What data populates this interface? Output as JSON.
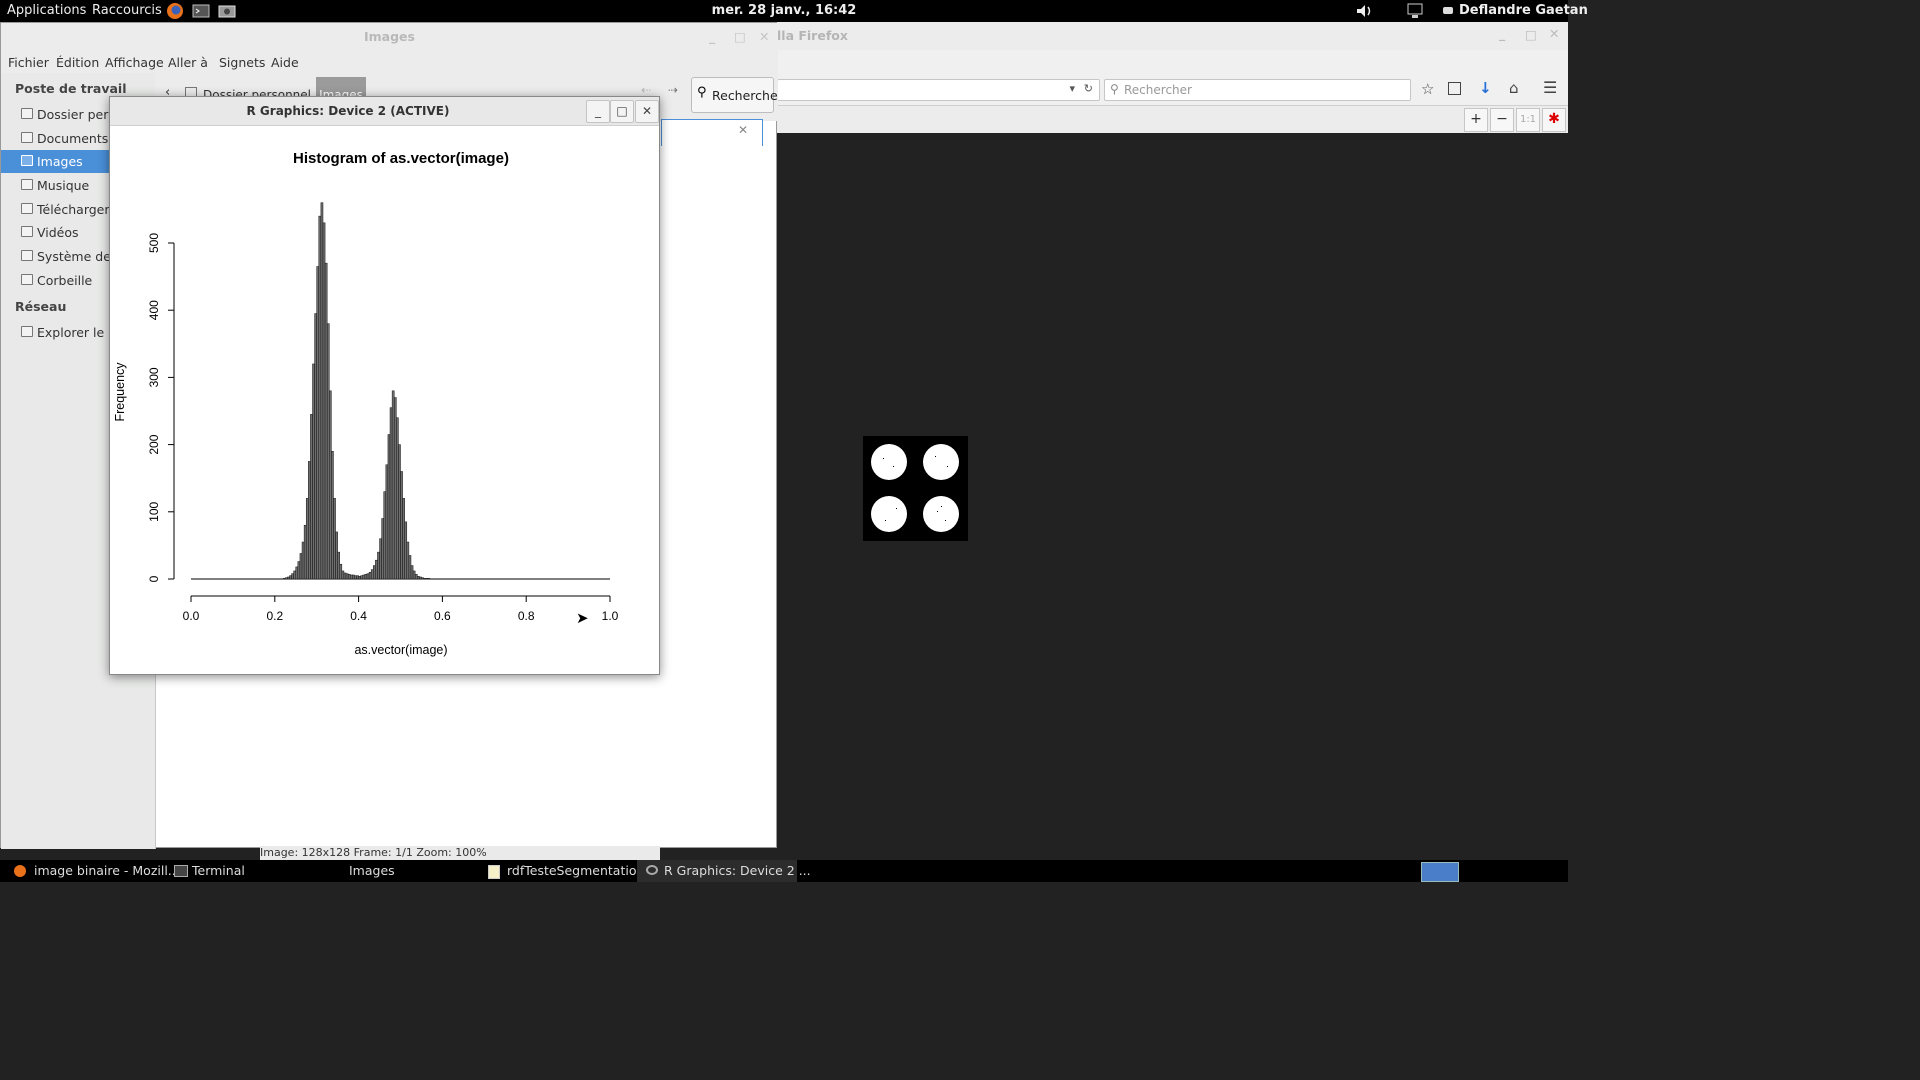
{
  "top_panel": {
    "applications": "Applications",
    "shortcuts": "Raccourcis",
    "clock": "mer. 28 janv., 16:42",
    "user": "Deflandre Gaetan",
    "launchers": [
      "firefox-icon",
      "terminal-icon",
      "screenshot-icon"
    ]
  },
  "firefox": {
    "title": "lla Firefox",
    "search_placeholder": "Rechercher",
    "zoom_one": "1:1"
  },
  "file_manager": {
    "title": "Images",
    "menu": [
      "Fichier",
      "Édition",
      "Affichage",
      "Aller à",
      "Signets",
      "Aide"
    ],
    "sidebar_heading_1": "Poste de travail",
    "sidebar_items": [
      {
        "label": "Dossier personnel",
        "selected": false
      },
      {
        "label": "Documents",
        "selected": false
      },
      {
        "label": "Images",
        "selected": true
      },
      {
        "label": "Musique",
        "selected": false
      },
      {
        "label": "Téléchargements",
        "selected": false
      },
      {
        "label": "Vidéos",
        "selected": false
      },
      {
        "label": "Système de fichiers",
        "selected": false
      },
      {
        "label": "Corbeille",
        "selected": false
      }
    ],
    "sidebar_heading_2": "Réseau",
    "network_item": "Explorer le réseau",
    "path": [
      "Dossier personnel",
      "Images"
    ],
    "search_button": "Recherche"
  },
  "r_window": {
    "title": "R Graphics: Device 2 (ACTIVE)"
  },
  "image_viewer_status": "Image: 128x128    Frame: 1/1    Zoom: 100%",
  "chart_data": {
    "type": "bar",
    "title": "Histogram of as.vector(image)",
    "xlabel": "as.vector(image)",
    "ylabel": "Frequency",
    "xlim": [
      0,
      1
    ],
    "ylim": [
      0,
      500
    ],
    "x_ticks": [
      "0.0",
      "0.2",
      "0.4",
      "0.6",
      "0.8",
      "1.0"
    ],
    "y_ticks": [
      "0",
      "100",
      "200",
      "300",
      "400",
      "500"
    ],
    "bin_width": 0.005,
    "bin_start": 0.22,
    "values": [
      1,
      2,
      3,
      5,
      8,
      12,
      18,
      26,
      38,
      55,
      80,
      120,
      175,
      245,
      320,
      395,
      465,
      540,
      560,
      530,
      470,
      380,
      280,
      190,
      120,
      70,
      40,
      22,
      12,
      9,
      8,
      7,
      6,
      6,
      5,
      5,
      4,
      5,
      6,
      7,
      8,
      10,
      14,
      20,
      28,
      40,
      60,
      90,
      130,
      170,
      215,
      255,
      280,
      270,
      240,
      200,
      160,
      120,
      85,
      55,
      35,
      20,
      12,
      7,
      4,
      3,
      2,
      1,
      1,
      1
    ]
  },
  "taskbar": {
    "items": [
      {
        "label": "image binaire - Mozill...",
        "icon": "firefox-icon",
        "active": false
      },
      {
        "label": "Terminal",
        "icon": "terminal-icon",
        "active": false
      },
      {
        "label": "Images",
        "icon": "folder-icon",
        "active": false
      },
      {
        "label": "rdfTesteSegmentatio...",
        "icon": "text-editor-icon",
        "active": false
      },
      {
        "label": "R Graphics: Device 2 ...",
        "icon": "r-icon",
        "active": true
      }
    ]
  }
}
